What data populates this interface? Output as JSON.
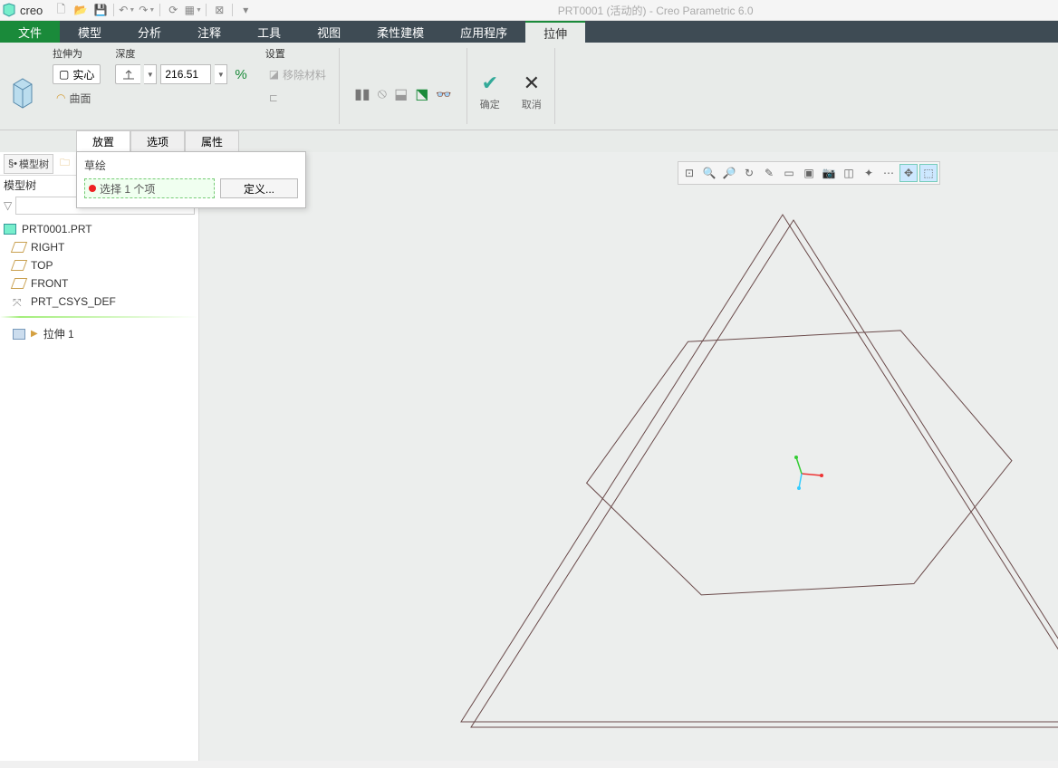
{
  "app": {
    "name": "creo",
    "window_title": "PRT0001 (活动的) - Creo Parametric 6.0"
  },
  "tabs": {
    "file": "文件",
    "items": [
      "模型",
      "分析",
      "注释",
      "工具",
      "视图",
      "柔性建模",
      "应用程序",
      "拉伸"
    ],
    "active": "拉伸"
  },
  "ribbon": {
    "extrude_as": {
      "label": "拉伸为",
      "solid": "实心",
      "surface": "曲面"
    },
    "depth": {
      "label": "深度",
      "value": "216.51"
    },
    "settings": {
      "label": "设置",
      "remove_mat": "移除材料"
    },
    "ok": "确定",
    "cancel": "取消"
  },
  "dashboard_tabs": {
    "place": "放置",
    "options": "选项",
    "props": "属性",
    "active": "放置"
  },
  "float": {
    "title": "草绘",
    "selection": "选择 1 个项",
    "define": "定义..."
  },
  "sidebar": {
    "tab_model_tree": "模型树",
    "title": "模型树",
    "root": "PRT0001.PRT",
    "items": [
      "RIGHT",
      "TOP",
      "FRONT",
      "PRT_CSYS_DEF"
    ],
    "feature": "拉伸 1"
  }
}
